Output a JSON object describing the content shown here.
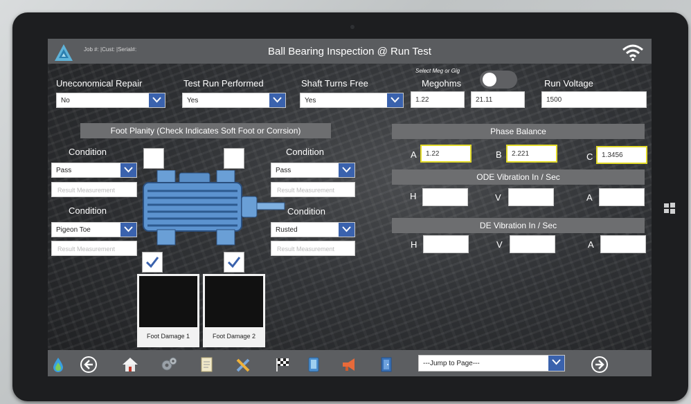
{
  "header": {
    "title": "Ball Bearing Inspection @ Run Test",
    "job_info": "Job #: |Cust: |Serial#:"
  },
  "top_fields": {
    "uneconomical_repair": {
      "label": "Uneconomical Repair",
      "value": "No"
    },
    "test_run_performed": {
      "label": "Test Run Performed",
      "value": "Yes"
    },
    "shaft_turns_free": {
      "label": "Shaft Turns Free",
      "value": "Yes"
    },
    "megohms": {
      "toggle_label": "Select Meg or Gig",
      "label": "Megohms",
      "value1": "1.22",
      "value2": "21.11"
    },
    "run_voltage": {
      "label": "Run Voltage",
      "value": "1500"
    }
  },
  "foot_planity": {
    "heading": "Foot Planity (Check Indicates Soft Foot or Corrsion)",
    "result_placeholder": "Result Measurement",
    "top_left": {
      "label": "Condition",
      "value": "Pass"
    },
    "top_right": {
      "label": "Condition",
      "value": "Pass"
    },
    "bottom_left": {
      "label": "Condition",
      "value": "Pigeon Toe"
    },
    "bottom_right": {
      "label": "Condition",
      "value": "Rusted"
    },
    "photo1_caption": "Foot Damage 1",
    "photo2_caption": "Foot Damage 2"
  },
  "phase_balance": {
    "heading": "Phase Balance",
    "a_label": "A",
    "a_value": "1.22",
    "b_label": "B",
    "b_value": "2.221",
    "c_label": "C",
    "c_value": "1.3456"
  },
  "ode_vibration": {
    "heading": "ODE Vibration In / Sec",
    "h": "H",
    "v": "V",
    "a": "A"
  },
  "de_vibration": {
    "heading": "DE Vibration In / Sec",
    "h": "H",
    "v": "V",
    "a": "A"
  },
  "footer": {
    "jump_placeholder": "---Jump to Page---"
  },
  "colors": {
    "accent": "#3a62ad",
    "highlight_border": "#e3db2a",
    "header_bg": "#5a5c5f"
  }
}
